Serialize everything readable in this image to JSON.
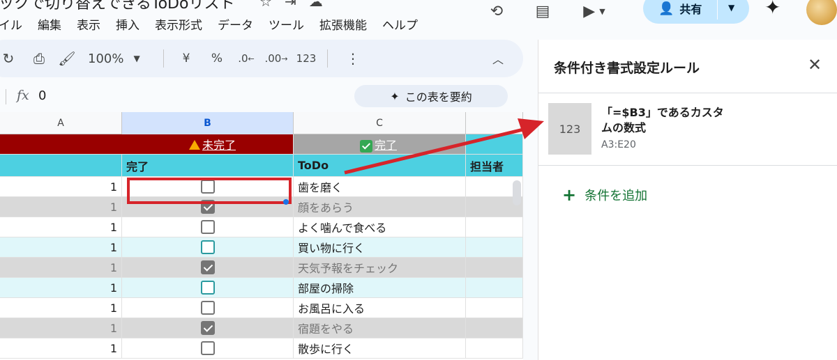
{
  "document": {
    "title": "ックで切り替えできるToDoリスト",
    "menu": [
      "イル",
      "編集",
      "表示",
      "挿入",
      "表示形式",
      "データ",
      "ツール",
      "拡張機能",
      "ヘルプ"
    ]
  },
  "header": {
    "share_label": "共有"
  },
  "toolbar": {
    "zoom": "100%",
    "currency": "¥",
    "percent": "%",
    "decrease_decimal": ".0",
    "increase_decimal": ".00",
    "number_format": "123"
  },
  "formula_bar": {
    "fx": "fx",
    "value": "0",
    "summarize_label": "この表を要約"
  },
  "grid": {
    "columns": [
      "A",
      "B",
      "C"
    ],
    "status_row": {
      "incomplete": "未完了",
      "complete": "完了"
    },
    "header_row": {
      "done": "完了",
      "todo": "ToDo",
      "owner": "担当者"
    },
    "rows": [
      {
        "a": "1",
        "checked": false,
        "todo": "歯を磨く",
        "style": "white"
      },
      {
        "a": "1",
        "checked": true,
        "todo": "顔をあらう",
        "style": "gray"
      },
      {
        "a": "1",
        "checked": false,
        "todo": "よく噛んで食べる",
        "style": "white"
      },
      {
        "a": "1",
        "checked": false,
        "todo": "買い物に行く",
        "style": "cyan"
      },
      {
        "a": "1",
        "checked": true,
        "todo": "天気予報をチェック",
        "style": "gray"
      },
      {
        "a": "1",
        "checked": false,
        "todo": "部屋の掃除",
        "style": "cyan"
      },
      {
        "a": "1",
        "checked": false,
        "todo": "お風呂に入る",
        "style": "white"
      },
      {
        "a": "1",
        "checked": true,
        "todo": "宿題をやる",
        "style": "gray"
      },
      {
        "a": "1",
        "checked": false,
        "todo": "散歩に行く",
        "style": "white"
      }
    ]
  },
  "panel": {
    "title": "条件付き書式設定ルール",
    "rule_thumb": "123",
    "rule_text": "「=$B3」であるカスタムの数式",
    "rule_range": "A3:E20",
    "add_rule": "条件を追加"
  },
  "colors": {
    "status_red": "#990000",
    "status_gray": "#a6a6a6",
    "header_cyan": "#4dd0e1",
    "row_gray": "#d9d9d9",
    "row_cyan": "#e0f7fa",
    "highlight_red": "#d6242a",
    "add_green": "#137333"
  }
}
